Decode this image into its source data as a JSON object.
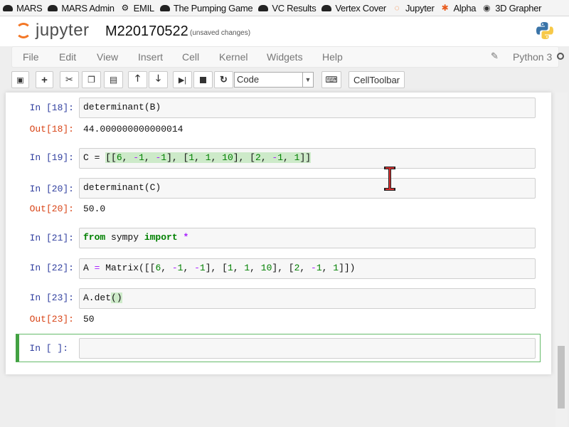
{
  "bookmarks": [
    {
      "label": "MARS",
      "icon": "hat-icon"
    },
    {
      "label": "MARS Admin",
      "icon": "hat-icon"
    },
    {
      "label": "EMIL",
      "icon": "gear-icon"
    },
    {
      "label": "The Pumping Game",
      "icon": "hat-icon"
    },
    {
      "label": "VC Results",
      "icon": "hat-icon"
    },
    {
      "label": "Vertex Cover",
      "icon": "hat-icon"
    },
    {
      "label": "Jupyter",
      "icon": "jupyter-icon"
    },
    {
      "label": "Alpha",
      "icon": "wolfram-icon"
    },
    {
      "label": "3D Grapher",
      "icon": "grapher-icon"
    }
  ],
  "header": {
    "logo_text": "jupyter",
    "notebook_name": "M220170522",
    "autosave": "(unsaved changes)"
  },
  "menubar": {
    "items": [
      "File",
      "Edit",
      "View",
      "Insert",
      "Cell",
      "Kernel",
      "Widgets",
      "Help"
    ],
    "kernel_name": "Python 3"
  },
  "toolbar": {
    "cell_type": "Code",
    "celltoolbar_label": "CellToolbar"
  },
  "cells": {
    "c18": {
      "in": "In [18]:",
      "code": "determinant(B)",
      "out_prompt": "Out[18]:",
      "out": "44.000000000000014"
    },
    "c19": {
      "in": "In [19]:"
    },
    "c20": {
      "in": "In [20]:",
      "code": "determinant(C)",
      "out_prompt": "Out[20]:",
      "out": "50.0"
    },
    "c21": {
      "in": "In [21]:"
    },
    "c22": {
      "in": "In [22]:"
    },
    "c23": {
      "in": "In [23]:",
      "out_prompt": "Out[23]:",
      "out": "50"
    },
    "c24": {
      "in": "In [ ]:"
    }
  }
}
